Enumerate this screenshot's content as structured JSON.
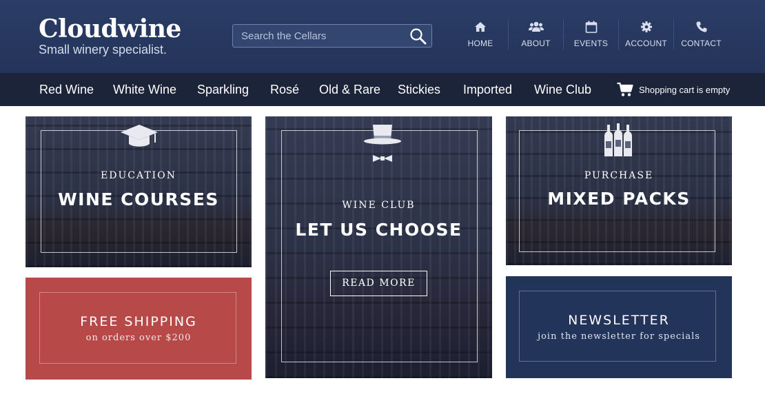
{
  "brand": {
    "title": "Cloudwine",
    "tagline": "Small winery specialist."
  },
  "search": {
    "placeholder": "Search the Cellars",
    "icon": "search-icon"
  },
  "topnav": [
    {
      "label": "HOME",
      "icon": "home-icon"
    },
    {
      "label": "ABOUT",
      "icon": "users-icon"
    },
    {
      "label": "EVENTS",
      "icon": "calendar-icon"
    },
    {
      "label": "ACCOUNT",
      "icon": "gear-icon"
    },
    {
      "label": "CONTACT",
      "icon": "phone-icon"
    }
  ],
  "categories": [
    "Red Wine",
    "White Wine",
    "Sparkling",
    "Rosé",
    "Old & Rare",
    "Stickies",
    "Imported",
    "Wine Club"
  ],
  "cart": {
    "label": "Shopping cart is empty",
    "icon": "cart-icon"
  },
  "tiles": {
    "education": {
      "kicker": "EDUCATION",
      "headline": "WINE COURSES",
      "icon": "graduation-cap-icon"
    },
    "wine_club": {
      "kicker": "WINE CLUB",
      "headline": "LET US CHOOSE",
      "button": "READ MORE",
      "icon": "top-hat-bowtie-icon"
    },
    "purchase": {
      "kicker": "PURCHASE",
      "headline": "MIXED PACKS",
      "icon": "wine-bottles-icon"
    },
    "shipping": {
      "title": "FREE SHIPPING",
      "subtitle": "on orders over $200"
    },
    "newsletter": {
      "title": "NEWSLETTER",
      "subtitle": "join the newsletter for specials"
    }
  },
  "colors": {
    "header_bg": "#27395f",
    "catnav_bg": "#1b2438",
    "shipping_bg": "#b74a48",
    "newsletter_bg": "#23345a"
  }
}
